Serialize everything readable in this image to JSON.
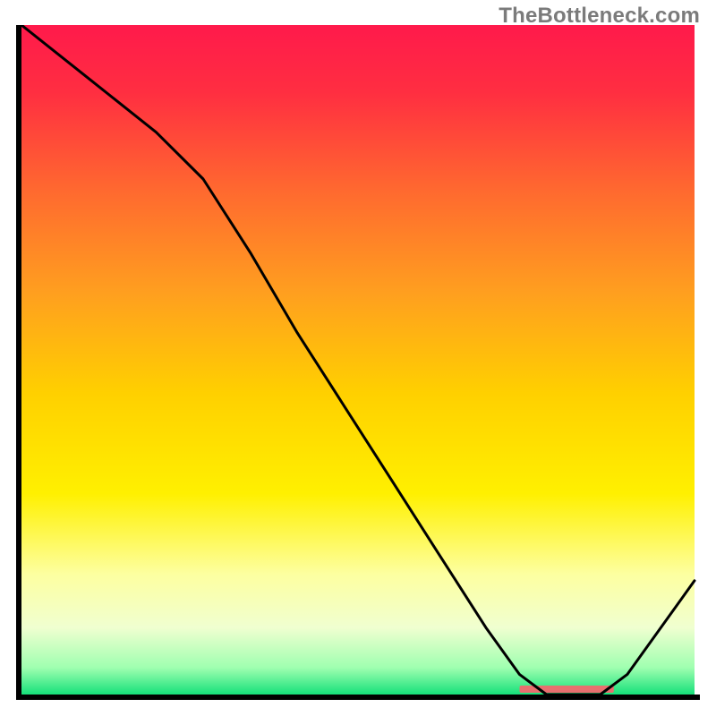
{
  "watermark": "TheBottleneck.com",
  "chart_data": {
    "type": "line",
    "title": "",
    "xlabel": "",
    "ylabel": "",
    "xlim": [
      0,
      100
    ],
    "ylim": [
      0,
      100
    ],
    "x": [
      0,
      10,
      20,
      27,
      34,
      41,
      48,
      55,
      62,
      69,
      74,
      78,
      82,
      86,
      90,
      100
    ],
    "values": [
      100,
      92,
      84,
      77,
      66,
      54,
      43,
      32,
      21,
      10,
      3,
      0,
      0,
      0,
      3,
      17
    ],
    "gradient_stops": [
      {
        "offset": 0.0,
        "color": "#ff1a4b"
      },
      {
        "offset": 0.1,
        "color": "#ff2e41"
      },
      {
        "offset": 0.25,
        "color": "#ff6a2f"
      },
      {
        "offset": 0.4,
        "color": "#ff9f1f"
      },
      {
        "offset": 0.55,
        "color": "#ffd000"
      },
      {
        "offset": 0.7,
        "color": "#fff000"
      },
      {
        "offset": 0.82,
        "color": "#fdffa0"
      },
      {
        "offset": 0.9,
        "color": "#f0ffd0"
      },
      {
        "offset": 0.96,
        "color": "#9fffb0"
      },
      {
        "offset": 1.0,
        "color": "#16e07a"
      }
    ],
    "marker_band": {
      "x0": 74,
      "x1": 88,
      "y": 0.8,
      "color": "#e86f6f"
    },
    "axis": {
      "stroke": "#000000",
      "width": 6
    },
    "line": {
      "stroke": "#000000",
      "width": 3
    }
  }
}
